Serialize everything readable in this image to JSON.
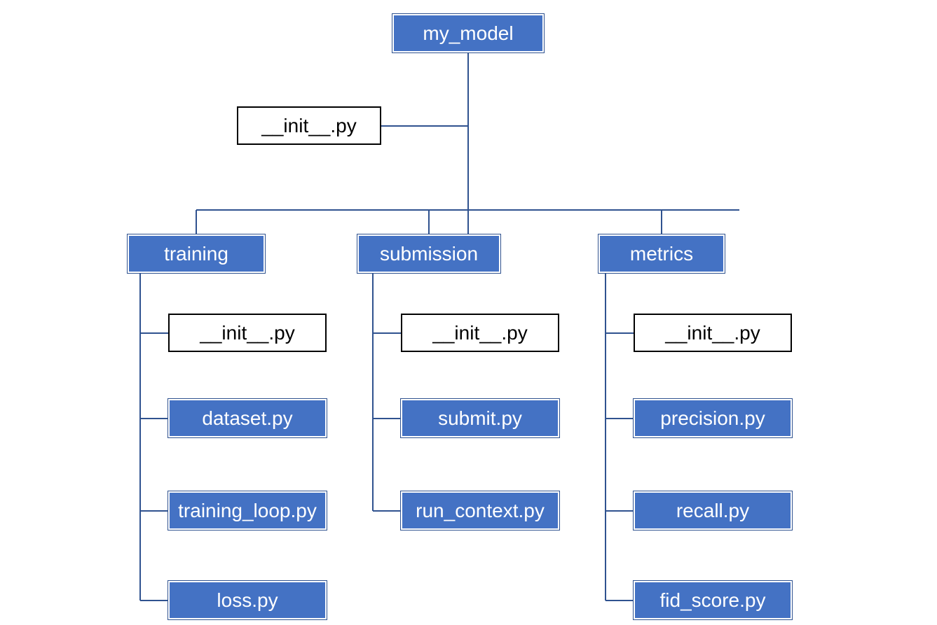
{
  "colors": {
    "folder_fill": "#4472C4",
    "folder_text": "#ffffff",
    "file_plain_border": "#000000",
    "connector": "#2F528F"
  },
  "root": {
    "label": "my_model",
    "init": "__init__.py"
  },
  "packages": {
    "training": {
      "label": "training",
      "files": {
        "init": "__init__.py",
        "dataset": "dataset.py",
        "training_loop": "training_loop.py",
        "loss": "loss.py"
      }
    },
    "submission": {
      "label": "submission",
      "files": {
        "init": "__init__.py",
        "submit": "submit.py",
        "run_context": "run_context.py"
      }
    },
    "metrics": {
      "label": "metrics",
      "files": {
        "init": "__init__.py",
        "precision": "precision.py",
        "recall": "recall.py",
        "fid_score": "fid_score.py"
      }
    }
  }
}
